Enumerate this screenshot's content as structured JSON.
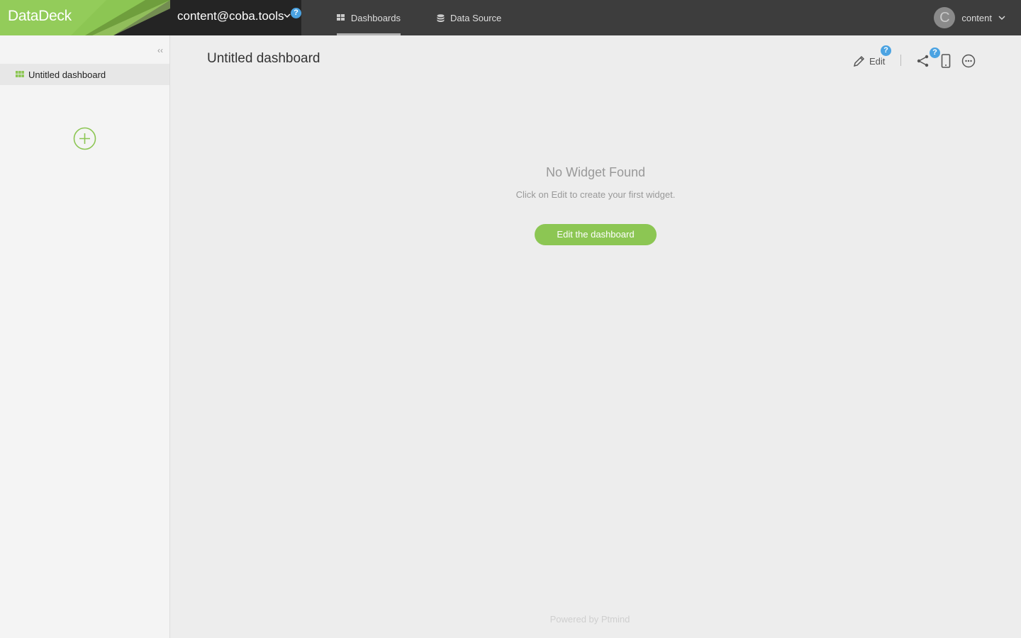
{
  "app": {
    "logo_text": "DataDeck",
    "brand_color": "#8cc653"
  },
  "header": {
    "account_email": "content@coba.tools",
    "help_badge": "?",
    "tabs": [
      {
        "label": "Dashboards",
        "icon": "dashboard-icon",
        "active": true
      },
      {
        "label": "Data Source",
        "icon": "database-icon",
        "active": false
      }
    ],
    "user": {
      "avatar_letter": "C",
      "name": "content"
    }
  },
  "sidebar": {
    "collapse_glyph": "‹‹",
    "items": [
      {
        "label": "Untitled dashboard",
        "icon": "dashboard-grid-icon",
        "selected": true
      }
    ],
    "add_icon": "plus-circle-icon"
  },
  "main": {
    "title": "Untitled dashboard",
    "toolbar": {
      "edit_label": "Edit",
      "help_badge": "?",
      "icons": [
        "pencil-icon",
        "share-icon",
        "mobile-icon",
        "more-icon"
      ]
    },
    "empty_state": {
      "title": "No Widget Found",
      "subtitle": "Click on Edit to create your first widget.",
      "button_label": "Edit the dashboard"
    },
    "footer": "Powered by Ptmind"
  }
}
